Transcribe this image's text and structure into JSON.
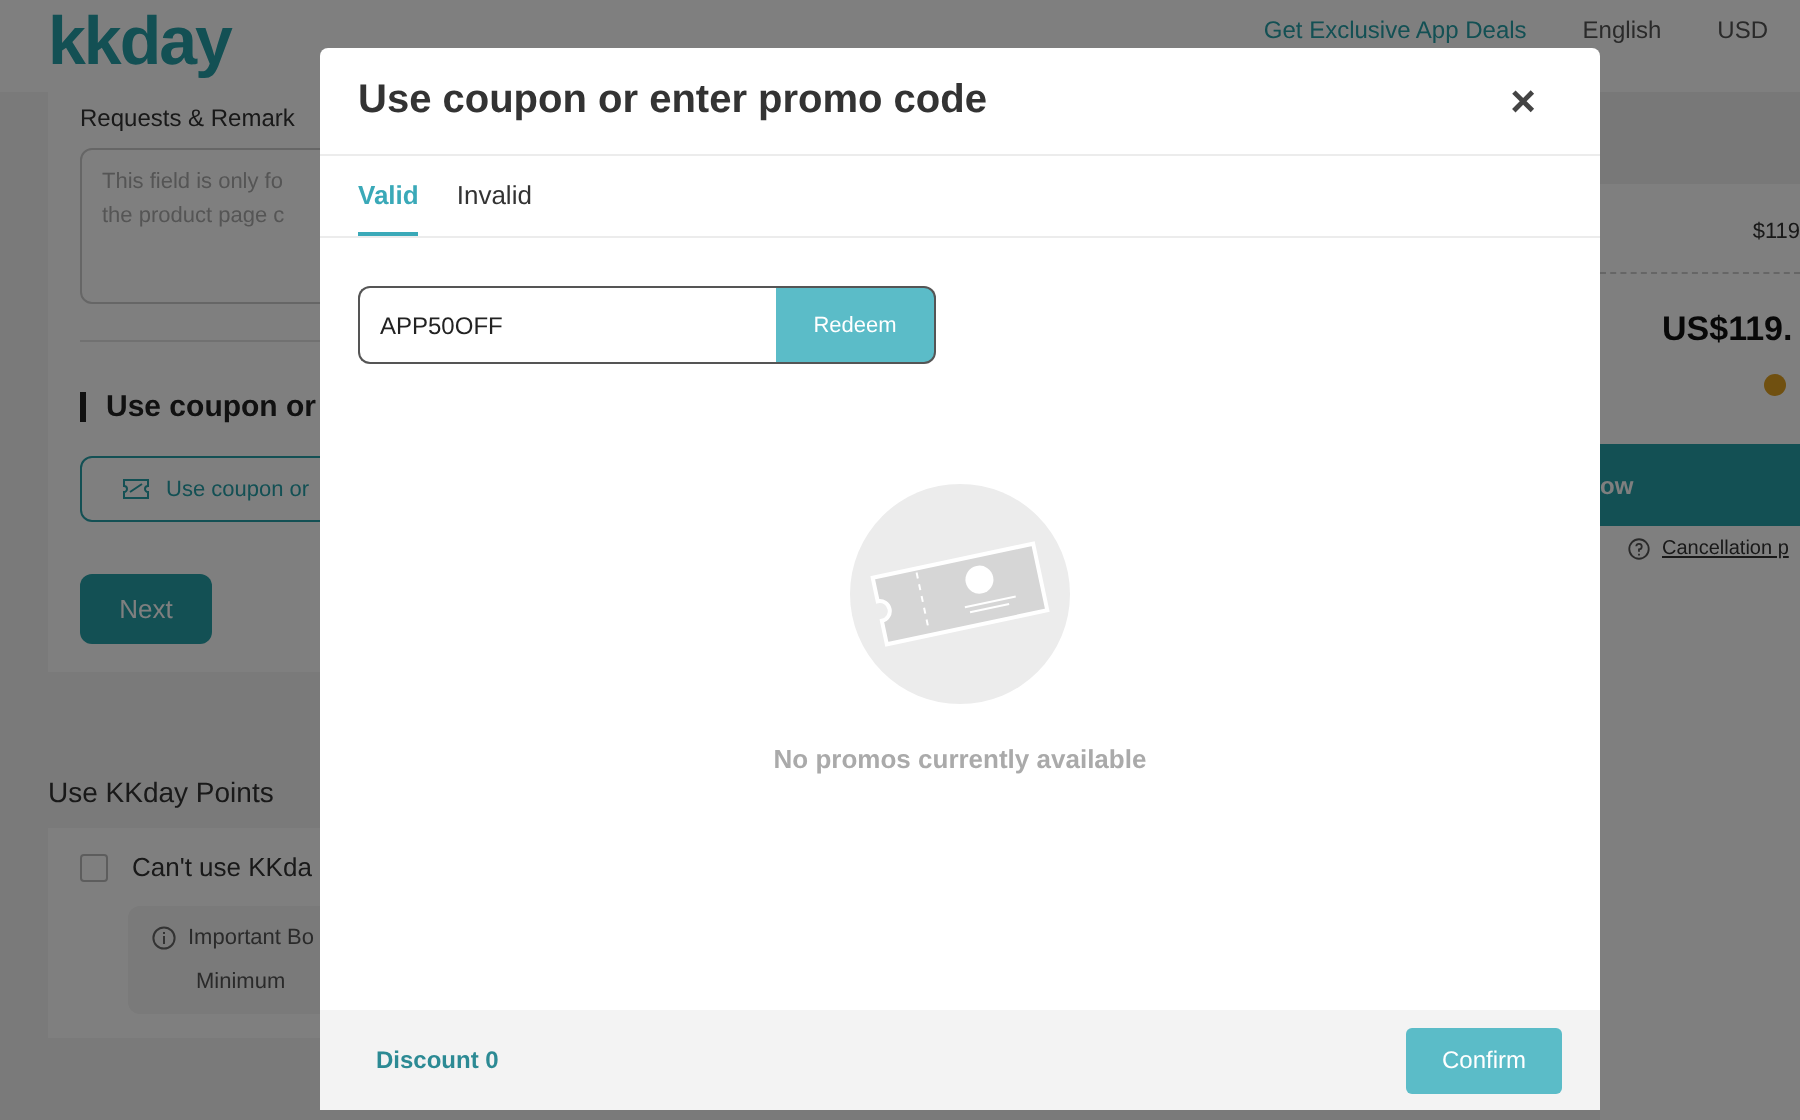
{
  "header": {
    "logo": "kkday",
    "app_deals": "Get Exclusive App Deals",
    "language": "English",
    "currency": "USD"
  },
  "booking": {
    "remarks_label": "Requests & Remark",
    "remarks_placeholder": [
      "This field is only fo",
      "the product page c"
    ],
    "coupon_heading": "Use coupon or",
    "coupon_button": "Use coupon or",
    "next_button": "Next"
  },
  "points": {
    "title": "Use KKday Points",
    "option": {
      "label": "Can't use KKda",
      "checked": false
    },
    "notice_title": "Important Bo",
    "notice_items": [
      "Minimum"
    ]
  },
  "summary": {
    "subtotal": "$119",
    "total": "US$119.",
    "book_button": "ow",
    "cancellation_link": "Cancellation p"
  },
  "modal": {
    "title": "Use coupon or enter promo code",
    "close": "×",
    "tabs": [
      {
        "label": "Valid",
        "selected": true
      },
      {
        "label": "Invalid",
        "selected": false
      }
    ],
    "promo_field": {
      "value": "APP50OFF"
    },
    "redeem_button": "Redeem",
    "empty_message": "No promos currently available",
    "discount": "Discount 0",
    "confirm_button": "Confirm"
  }
}
